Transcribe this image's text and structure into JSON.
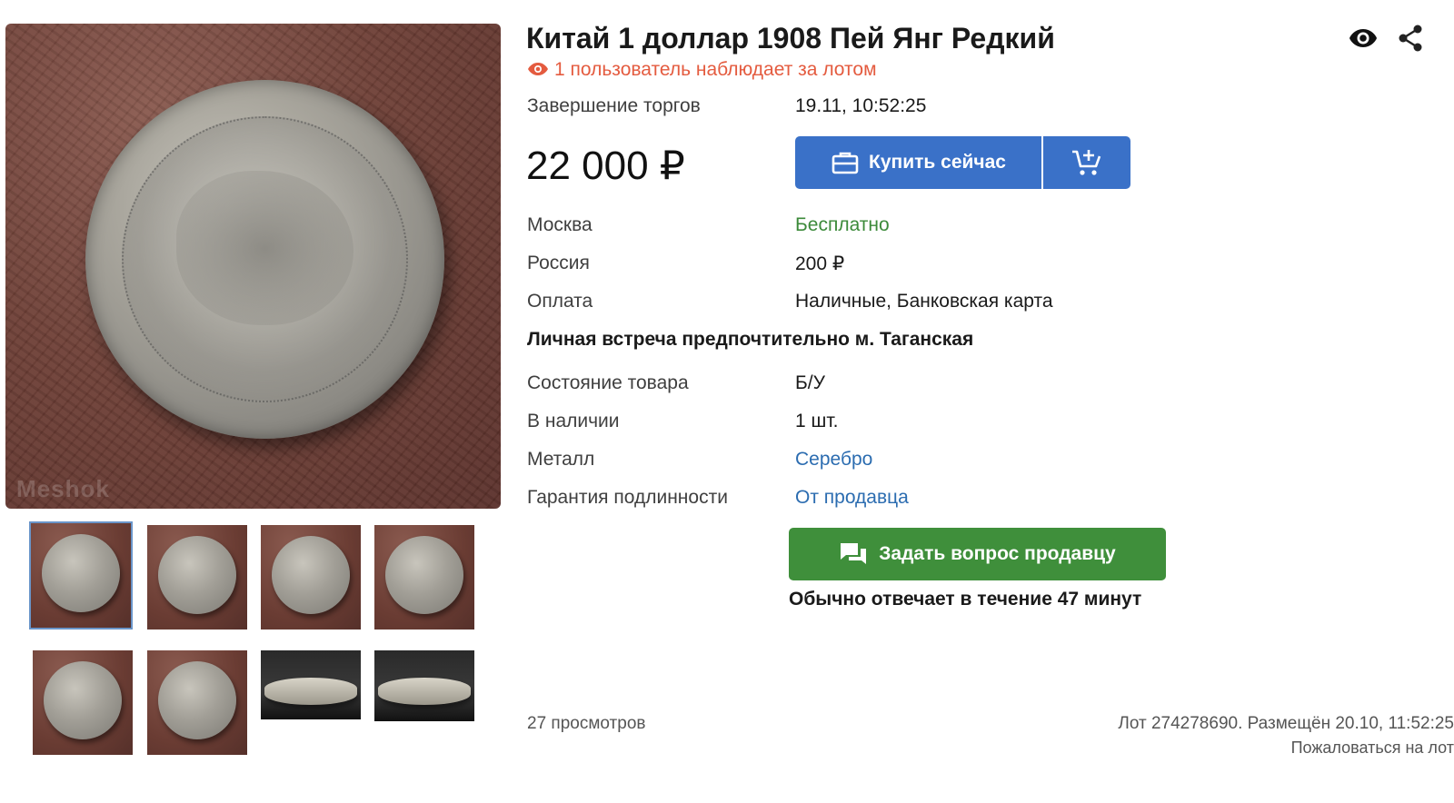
{
  "lot": {
    "title": "Китай 1 доллар 1908 Пей Янг Редкий",
    "watchers": "1 пользователь наблюдает за лотом",
    "price": "22 000 ₽"
  },
  "main_photo": {
    "watermark": "Meshok"
  },
  "thumbnails_count": 8,
  "details": {
    "end_label": "Завершение торгов",
    "end_value": "19.11, 10:52:25",
    "moscow_label": "Москва",
    "moscow_value": "Бесплатно",
    "russia_label": "Россия",
    "russia_value": "200 ₽",
    "payment_label": "Оплата",
    "payment_value": "Наличные, Банковская карта",
    "meeting_note": "Личная встреча предпочтительно м. Таганская",
    "condition_label": "Состояние товара",
    "condition_value": "Б/У",
    "stock_label": "В наличии",
    "stock_value": "1 шт.",
    "metal_label": "Металл",
    "metal_value": "Серебро",
    "guarantee_label": "Гарантия подлинности",
    "guarantee_value": "От продавца"
  },
  "buttons": {
    "buy_now": "Купить сейчас",
    "ask_seller": "Задать вопрос продавцу"
  },
  "reply_note": "Обычно отвечает в течение 47 минут",
  "footer": {
    "views": "27 просмотров",
    "lot_info": "Лот 274278690. Размещён 20.10, 11:52:25",
    "report": "Пожаловаться на лот"
  },
  "icons": {
    "watch": "eye-icon",
    "share": "share-icon",
    "buy": "briefcase-icon",
    "cart": "add-to-cart-icon",
    "chat": "chat-icon"
  },
  "colors": {
    "accent_blue": "#3a71c8",
    "success_green": "#3f8f3b",
    "watchers_red": "#e45b3f",
    "link_blue": "#2b6cb0"
  }
}
